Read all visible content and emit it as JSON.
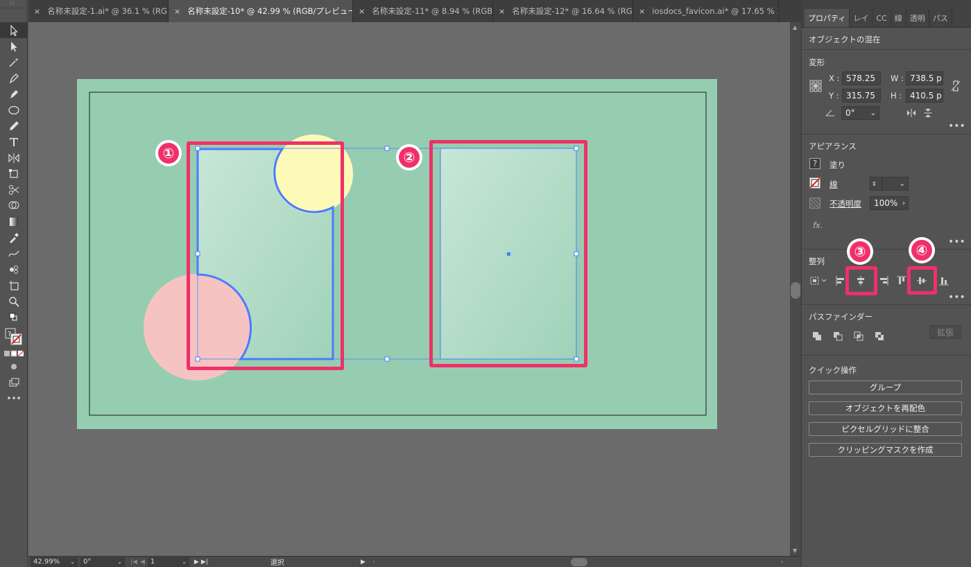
{
  "tabs": [
    {
      "title": "名称未設定-1.ai* @ 36.1 % (RGB...",
      "active": false
    },
    {
      "title": "名称未設定-10* @ 42.99 % (RGB/プレビュー)",
      "active": true
    },
    {
      "title": "名称未設定-11* @ 8.94 % (RGB/...",
      "active": false
    },
    {
      "title": "名称未設定-12* @ 16.64 % (RG...",
      "active": false
    },
    {
      "title": "iosdocs_favicon.ai* @ 17.65 % ...",
      "active": false
    }
  ],
  "close_glyph": "×",
  "panel": {
    "tabs": [
      "プロパティ",
      "レイ",
      "CC",
      "線",
      "透明",
      "パス"
    ],
    "selection_type": "オブジェクトの混在",
    "transform": {
      "title": "変形",
      "x_label": "X :",
      "x": "578.25",
      "y_label": "Y :",
      "y": "315.75",
      "w_label": "W :",
      "w": "738.5 p",
      "h_label": "H :",
      "h": "410.5 p",
      "angle": "0°"
    },
    "appearance": {
      "title": "アピアランス",
      "fill_label": "塗り",
      "stroke_label": "線",
      "opacity_label": "不透明度",
      "opacity": "100%",
      "fx": "fx.",
      "question": "?"
    },
    "align": {
      "title": "整列"
    },
    "pathfinder": {
      "title": "パスファインダー",
      "expand": "拡張"
    },
    "quick_actions": {
      "title": "クイック操作",
      "buttons": [
        "グループ",
        "オブジェクトを再配色",
        "ピクセルグリッドに整合",
        "クリッピングマスクを作成"
      ]
    },
    "more": "•••"
  },
  "annotations": [
    "①",
    "②",
    "③",
    "④"
  ],
  "status": {
    "zoom": "42.99%",
    "rotation": "0°",
    "artboard": "1",
    "tool": "選択"
  },
  "colors": {
    "artboard": "#96cdb1",
    "annotation": "#f0306a",
    "selection": "#4a7cff",
    "yellow_circle": "#fdf9b7",
    "pink_circle": "#f5c4c2"
  }
}
